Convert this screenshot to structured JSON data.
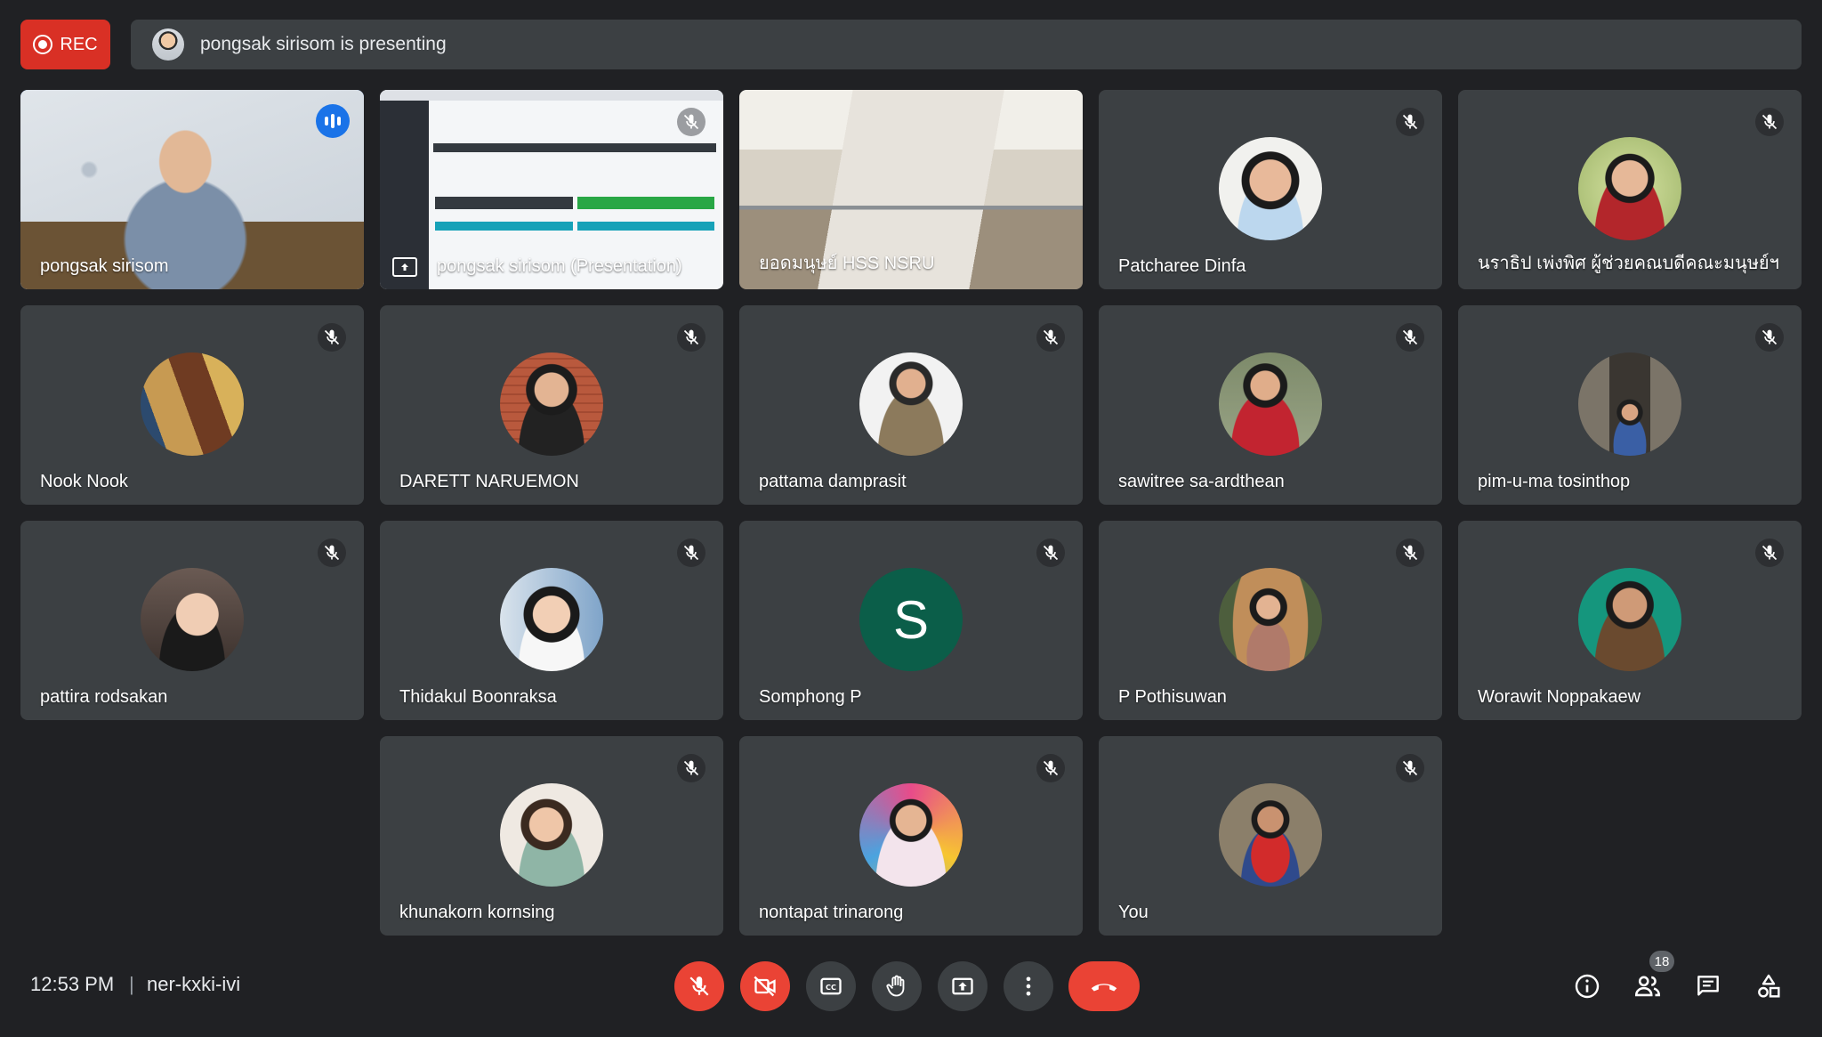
{
  "header": {
    "rec_label": "REC",
    "presenting_text": "pongsak sirisom is presenting"
  },
  "tiles": [
    {
      "name": "pongsak sirisom",
      "type": "video-cam"
    },
    {
      "name": "pongsak sirisom (Presentation)",
      "type": "video-screen"
    },
    {
      "name": "ยอดมนุษย์ HSS NSRU",
      "type": "video-room"
    },
    {
      "name": "Patcharee Dinfa",
      "type": "avatar"
    },
    {
      "name": "นราธิป เพ่งพิศ ผู้ช่วยคณบดีคณะมนุษย์ฯ",
      "type": "avatar"
    },
    {
      "name": "Nook Nook",
      "type": "avatar"
    },
    {
      "name": "DARETT NARUEMON",
      "type": "avatar"
    },
    {
      "name": "pattama damprasit",
      "type": "avatar"
    },
    {
      "name": "sawitree sa-ardthean",
      "type": "avatar"
    },
    {
      "name": "pim-u-ma tosinthop",
      "type": "avatar"
    },
    {
      "name": "pattira rodsakan",
      "type": "avatar"
    },
    {
      "name": "Thidakul Boonraksa",
      "type": "avatar"
    },
    {
      "name": "Somphong P",
      "type": "letter",
      "letter": "S"
    },
    {
      "name": "P Pothisuwan",
      "type": "avatar"
    },
    {
      "name": "Worawit Noppakaew",
      "type": "avatar"
    },
    {
      "name": "khunakorn kornsing",
      "type": "avatar"
    },
    {
      "name": "nontapat trinarong",
      "type": "avatar"
    },
    {
      "name": "You",
      "type": "avatar"
    }
  ],
  "footer": {
    "time": "12:53 PM",
    "separator": "|",
    "meeting_code": "ner-kxki-ivi",
    "participants_count": "18"
  },
  "colors": {
    "background": "#202124",
    "tile": "#3c4043",
    "danger": "#ea4335",
    "active_speaker": "#4a8df8"
  }
}
